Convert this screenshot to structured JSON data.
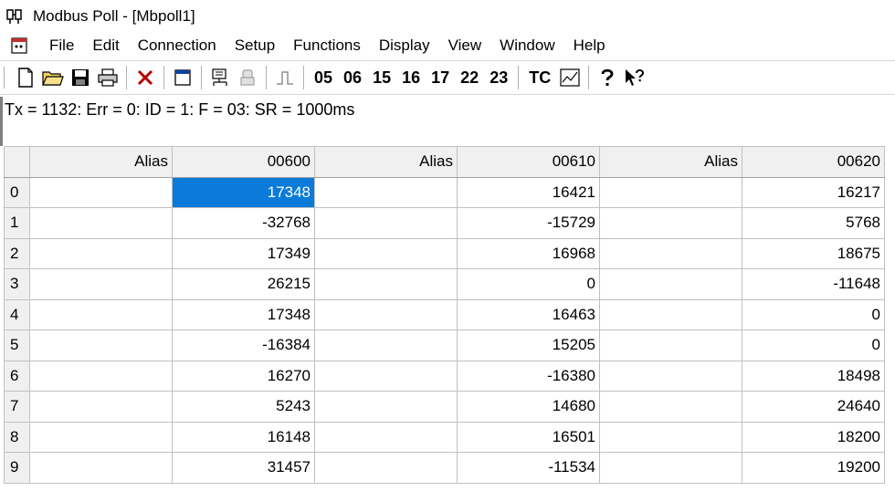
{
  "window": {
    "title": "Modbus Poll - [Mbpoll1]"
  },
  "menu": {
    "items": [
      "File",
      "Edit",
      "Connection",
      "Setup",
      "Functions",
      "Display",
      "View",
      "Window",
      "Help"
    ]
  },
  "toolbar": {
    "function_codes": [
      "05",
      "06",
      "15",
      "16",
      "17",
      "22",
      "23"
    ],
    "tc_label": "TC"
  },
  "status": {
    "text": "Tx = 1132: Err = 0: ID = 1: F = 03: SR = 1000ms"
  },
  "grid": {
    "headers": [
      "Alias",
      "00600",
      "Alias",
      "00610",
      "Alias",
      "00620"
    ],
    "rows": [
      {
        "index": "0",
        "values": [
          "17348",
          "16421",
          "16217"
        ]
      },
      {
        "index": "1",
        "values": [
          "-32768",
          "-15729",
          "5768"
        ]
      },
      {
        "index": "2",
        "values": [
          "17349",
          "16968",
          "18675"
        ]
      },
      {
        "index": "3",
        "values": [
          "26215",
          "0",
          "-11648"
        ]
      },
      {
        "index": "4",
        "values": [
          "17348",
          "16463",
          "0"
        ]
      },
      {
        "index": "5",
        "values": [
          "-16384",
          "15205",
          "0"
        ]
      },
      {
        "index": "6",
        "values": [
          "16270",
          "-16380",
          "18498"
        ]
      },
      {
        "index": "7",
        "values": [
          "5243",
          "14680",
          "24640"
        ]
      },
      {
        "index": "8",
        "values": [
          "16148",
          "16501",
          "18200"
        ]
      },
      {
        "index": "9",
        "values": [
          "31457",
          "-11534",
          "19200"
        ]
      }
    ]
  },
  "colors": {
    "selection": "#0a7bd8",
    "header_bg": "#f0f0f0",
    "grid_line": "#c0c0c0"
  }
}
